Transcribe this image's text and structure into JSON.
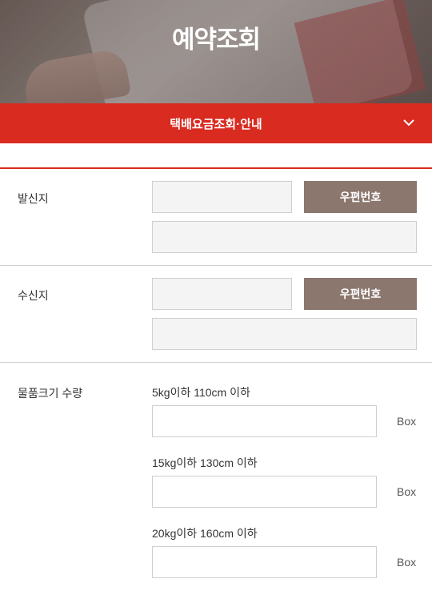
{
  "header": {
    "title": "예약조회"
  },
  "menu": {
    "selected": "택배요금조회·안내"
  },
  "form": {
    "sender": {
      "label": "발신지",
      "zip_button": "우편번호"
    },
    "receiver": {
      "label": "수신지",
      "zip_button": "우편번호"
    },
    "packages": {
      "label": "물품크기 수량",
      "items": [
        {
          "spec": "5kg이하 110cm 이하",
          "unit": "Box"
        },
        {
          "spec": "15kg이하 130cm 이하",
          "unit": "Box"
        },
        {
          "spec": "20kg이하 160cm 이하",
          "unit": "Box"
        }
      ]
    }
  },
  "colors": {
    "accent": "#d92b20",
    "button": "#8b776d"
  }
}
